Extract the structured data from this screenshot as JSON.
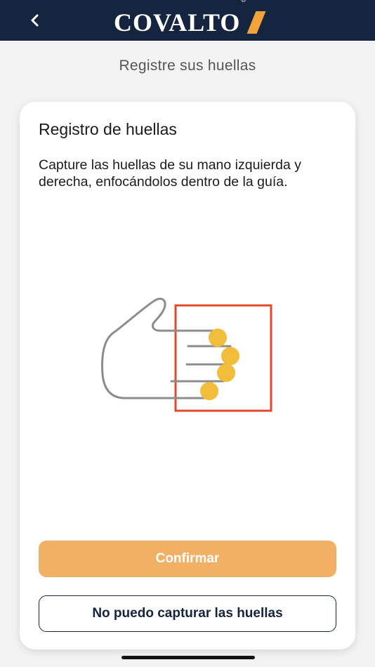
{
  "header": {
    "back_icon": "chevron-left-icon",
    "logo_text": "COVALTO",
    "logo_mark": "®",
    "colors": {
      "background": "#15253f",
      "accent": "#f2a33a"
    }
  },
  "page": {
    "subtitle": "Registre sus huellas"
  },
  "card": {
    "title": "Registro de huellas",
    "description": "Capture las huellas de su mano izquierda y derecha, enfocándolos dentro de la guía.",
    "illustration_icon": "hand-fingerprint-guide-icon"
  },
  "actions": {
    "confirm_label": "Confirmar",
    "cannot_capture_label": "No puedo capturar las huellas",
    "colors": {
      "confirm": "#f2b064",
      "secondary_border": "#15253f"
    }
  }
}
